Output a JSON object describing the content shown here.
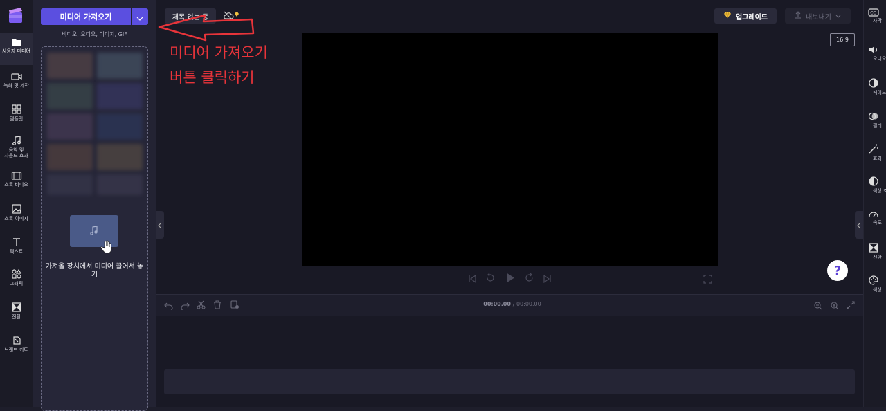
{
  "left_nav": [
    {
      "label": "사용자 미디어",
      "icon": "folder-icon",
      "active": true
    },
    {
      "label": "녹화 및 제작",
      "icon": "video-camera-icon"
    },
    {
      "label": "템플릿",
      "icon": "templates-icon"
    },
    {
      "label": "음악 및 사운드 효과",
      "icon": "music-icon"
    },
    {
      "label": "스톡 비디오",
      "icon": "film-icon"
    },
    {
      "label": "스톡 이미지",
      "icon": "image-icon"
    },
    {
      "label": "텍스트",
      "icon": "text-icon"
    },
    {
      "label": "그래픽",
      "icon": "shapes-icon"
    },
    {
      "label": "전환",
      "icon": "transition-icon"
    },
    {
      "label": "브랜드 키트",
      "icon": "brand-kit-icon"
    }
  ],
  "media_panel": {
    "import_button": "미디어 가져오기",
    "supported_types": "비디오, 오디오, 이미지, GIF",
    "drop_text": "가져올 장치에서 미디어 끌어서 놓기"
  },
  "header": {
    "project_title": "제목 없는 동",
    "upgrade_label": "업그레이드",
    "export_label": "내보내기"
  },
  "preview": {
    "aspect_ratio": "16:9"
  },
  "timeline": {
    "current_time": "00:00.00",
    "total_time": "/ 00:00.00"
  },
  "right_nav": [
    {
      "label": "자막",
      "icon": "captions-icon"
    },
    {
      "label": "오디오",
      "icon": "speaker-icon"
    },
    {
      "label": "페이드",
      "icon": "fade-icon"
    },
    {
      "label": "필터",
      "icon": "filter-icon"
    },
    {
      "label": "효과",
      "icon": "magic-wand-icon"
    },
    {
      "label": "색상 조",
      "icon": "color-adjust-icon"
    },
    {
      "label": "속도",
      "icon": "speed-icon"
    },
    {
      "label": "전환",
      "icon": "transition-icon"
    },
    {
      "label": "색상",
      "icon": "palette-icon"
    }
  ],
  "annotation": {
    "line1": "미디어 가져오기",
    "line2": "버튼 클릭하기",
    "color": "#e8343a"
  },
  "colors": {
    "accent": "#5b4fe0",
    "background": "#191925",
    "panel": "#232333"
  }
}
